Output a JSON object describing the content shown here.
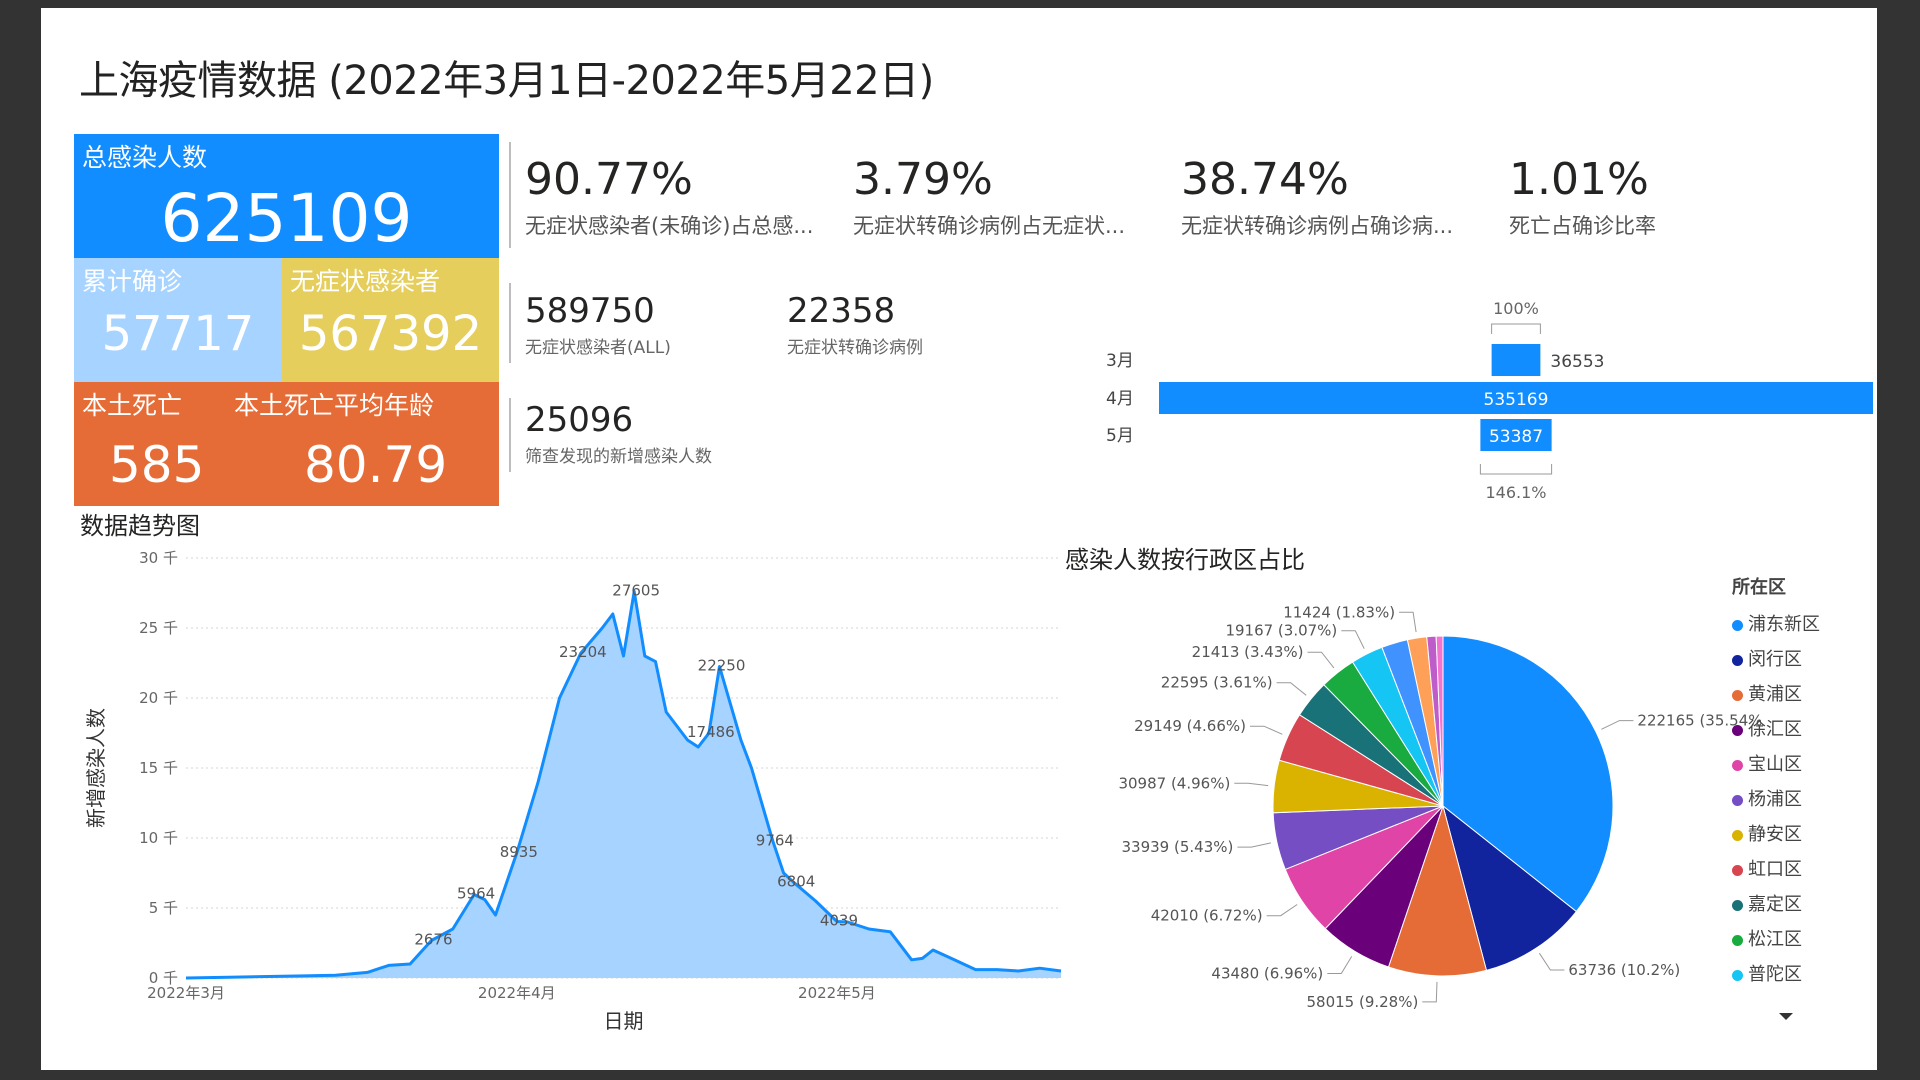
{
  "title": "上海疫情数据 (2022年3月1日-2022年5月22日)",
  "cards": {
    "total": {
      "label": "总感染人数",
      "value": "625109"
    },
    "confirmed": {
      "label": "累计确诊",
      "value": "57717"
    },
    "asymptomatic": {
      "label": "无症状感染者",
      "value": "567392"
    },
    "deaths": {
      "label": "本土死亡",
      "value": "585"
    },
    "avg_age": {
      "label": "本土死亡平均年龄",
      "value": "80.79"
    }
  },
  "kpis": [
    {
      "value": "90.77%",
      "label": "无症状感染者(未确诊)占总感..."
    },
    {
      "value": "3.79%",
      "label": "无症状转确诊病例占无症状..."
    },
    {
      "value": "38.74%",
      "label": "无症状转确诊病例占确诊病..."
    },
    {
      "value": "1.01%",
      "label": "死亡占确诊比率"
    }
  ],
  "stats": [
    {
      "value": "589750",
      "label": "无症状感染者(ALL)"
    },
    {
      "value": "22358",
      "label": "无症状转确诊病例"
    },
    {
      "value": "25096",
      "label": "筛查发现的新增感染人数"
    }
  ],
  "funnel": {
    "top_pct": "100%",
    "bottom_pct": "146.1%",
    "color": "#118DFF",
    "rows": [
      {
        "label": "3月",
        "value": 36553,
        "value_text": "36553"
      },
      {
        "label": "4月",
        "value": 535169,
        "value_text": "535169"
      },
      {
        "label": "5月",
        "value": 53387,
        "value_text": "53387"
      }
    ]
  },
  "trend": {
    "title": "数据趋势图",
    "ylabel": "新增感染人数",
    "xlabel": "日期",
    "yticks": [
      "30 千",
      "25 千",
      "20 千",
      "15 千",
      "10 千",
      "5 千",
      "0 千"
    ],
    "xticks": [
      "2022年3月",
      "2022年4月",
      "2022年5月"
    ],
    "line_color": "#118DFF",
    "fill_color": "#A6D3FF"
  },
  "pie": {
    "title": "感染人数按行政区占比",
    "legend_title": "所在区"
  },
  "chart_data": [
    {
      "type": "area",
      "title": "数据趋势图",
      "xlabel": "日期",
      "ylabel": "新增感染人数",
      "ylim": [
        0,
        30000
      ],
      "x_range": [
        "2022-03-01",
        "2022-05-22"
      ],
      "grid": true,
      "x": [
        "2022-03-01",
        "2022-03-05",
        "2022-03-08",
        "2022-03-12",
        "2022-03-15",
        "2022-03-18",
        "2022-03-20",
        "2022-03-22",
        "2022-03-24",
        "2022-03-26",
        "2022-03-28",
        "2022-03-29",
        "2022-03-30",
        "2022-04-01",
        "2022-04-03",
        "2022-04-05",
        "2022-04-07",
        "2022-04-09",
        "2022-04-10",
        "2022-04-11",
        "2022-04-12",
        "2022-04-13",
        "2022-04-14",
        "2022-04-15",
        "2022-04-17",
        "2022-04-18",
        "2022-04-19",
        "2022-04-20",
        "2022-04-22",
        "2022-04-23",
        "2022-04-25",
        "2022-04-26",
        "2022-04-27",
        "2022-04-29",
        "2022-05-01",
        "2022-05-02",
        "2022-05-04",
        "2022-05-06",
        "2022-05-08",
        "2022-05-09",
        "2022-05-10",
        "2022-05-12",
        "2022-05-14",
        "2022-05-16",
        "2022-05-18",
        "2022-05-20",
        "2022-05-22"
      ],
      "values": [
        0,
        50,
        100,
        150,
        200,
        400,
        900,
        1000,
        2676,
        3500,
        5964,
        5600,
        4500,
        8935,
        14000,
        20000,
        23204,
        25000,
        26000,
        23000,
        27605,
        23000,
        22600,
        19000,
        17000,
        16500,
        17486,
        22250,
        17000,
        15000,
        9764,
        7500,
        6800,
        5500,
        4039,
        4000,
        3500,
        3300,
        1300,
        1400,
        2000,
        1300,
        600,
        600,
        500,
        700,
        500
      ],
      "labels": [
        {
          "x": "2022-03-24",
          "v": 2676
        },
        {
          "x": "2022-03-28",
          "v": 5964
        },
        {
          "x": "2022-04-01",
          "v": 8935
        },
        {
          "x": "2022-04-07",
          "v": 23204
        },
        {
          "x": "2022-04-12",
          "v": 27605
        },
        {
          "x": "2022-04-19",
          "v": 17486
        },
        {
          "x": "2022-04-20",
          "v": 22250
        },
        {
          "x": "2022-04-25",
          "v": 9764
        },
        {
          "x": "2022-04-27",
          "v": 6804
        },
        {
          "x": "2022-05-01",
          "v": 4039
        }
      ]
    },
    {
      "type": "pie",
      "title": "感染人数按行政区占比",
      "legend_title": "所在区",
      "legend_position": "right",
      "slices": [
        {
          "name": "浦东新区",
          "value": 222165,
          "pct": "35.54%",
          "label": "222165 (35.54%)",
          "color": "#118DFF"
        },
        {
          "name": "闵行区",
          "value": 63736,
          "pct": "10.2%",
          "label": "63736 (10.2%)",
          "color": "#12239E"
        },
        {
          "name": "黄浦区",
          "value": 58015,
          "pct": "9.28%",
          "label": "58015 (9.28%)",
          "color": "#E66C37"
        },
        {
          "name": "徐汇区",
          "value": 43480,
          "pct": "6.96%",
          "label": "43480 (6.96%)",
          "color": "#6B007B"
        },
        {
          "name": "宝山区",
          "value": 42010,
          "pct": "6.72%",
          "label": "42010 (6.72%)",
          "color": "#E044A7"
        },
        {
          "name": "杨浦区",
          "value": 33939,
          "pct": "5.43%",
          "label": "33939 (5.43%)",
          "color": "#744EC2"
        },
        {
          "name": "静安区",
          "value": 30987,
          "pct": "4.96%",
          "label": "30987 (4.96%)",
          "color": "#D9B300"
        },
        {
          "name": "虹口区",
          "value": 29149,
          "pct": "4.66%",
          "label": "29149 (4.66%)",
          "color": "#D64550"
        },
        {
          "name": "嘉定区",
          "value": 22595,
          "pct": "3.61%",
          "label": "22595 (3.61%)",
          "color": "#197278"
        },
        {
          "name": "松江区",
          "value": 21413,
          "pct": "3.43%",
          "label": "21413 (3.43%)",
          "color": "#1AAB40"
        },
        {
          "name": "普陀区",
          "value": 19167,
          "pct": "3.07%",
          "label": "19167 (3.07%)",
          "color": "#15C6F4"
        },
        {
          "name": "",
          "value": 15500,
          "pct": "",
          "label": "",
          "color": "#4092FF"
        },
        {
          "name": "",
          "value": 11424,
          "pct": "1.83%",
          "label": "11424 (1.83%)",
          "color": "#FFA058"
        },
        {
          "name": "",
          "value": 5500,
          "pct": "",
          "label": "",
          "color": "#BE5DC9"
        },
        {
          "name": "",
          "value": 4000,
          "pct": "",
          "label": "",
          "color": "#F472D0"
        }
      ]
    }
  ]
}
